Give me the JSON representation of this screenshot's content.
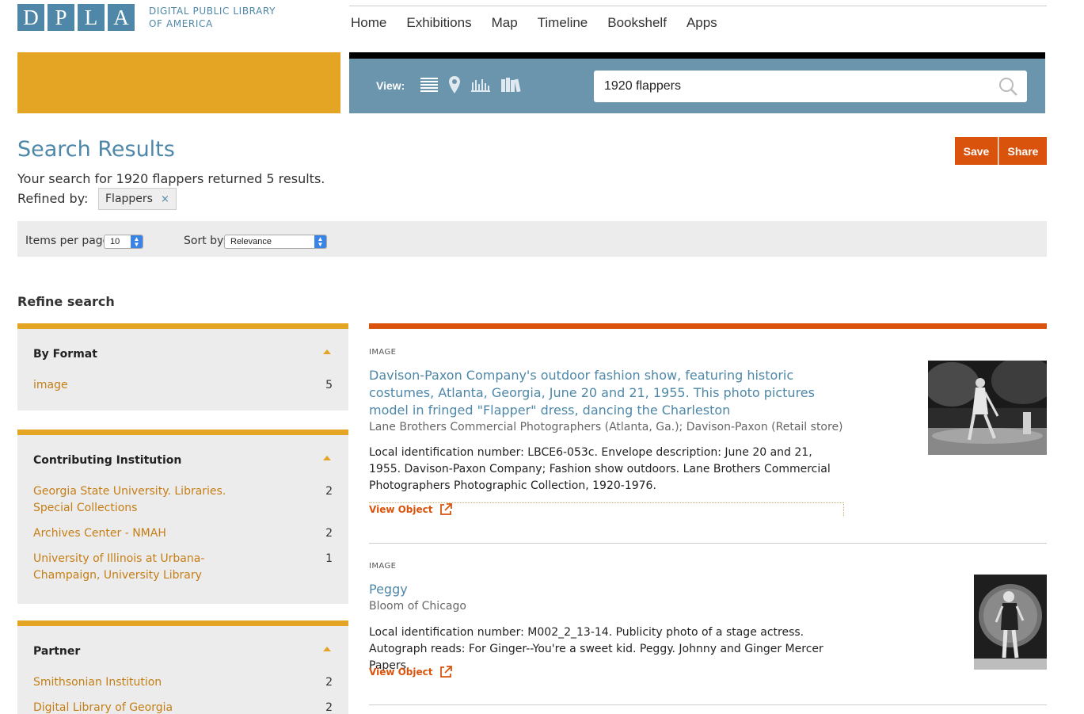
{
  "header": {
    "logo_letters": [
      "D",
      "P",
      "L",
      "A"
    ],
    "logo_line1": "DIGITAL PUBLIC LIBRARY",
    "logo_line2": "OF AMERICA",
    "nav": [
      "Home",
      "Exhibitions",
      "Map",
      "Timeline",
      "Bookshelf",
      "Apps"
    ]
  },
  "search": {
    "view_label": "View:",
    "view_icons": [
      "list-view-icon",
      "map-view-icon",
      "timeline-view-icon",
      "bookshelf-view-icon"
    ],
    "query": "1920 flappers"
  },
  "results_header": {
    "title": "Search Results",
    "save": "Save",
    "share": "Share",
    "summary": "Your search for 1920 flappers returned 5 results.",
    "refined_label": "Refined by:",
    "refine_chip": "Flappers",
    "chip_remove": "×"
  },
  "toolbar": {
    "items_per_page_label": "Items per page:",
    "items_per_page_value": "10",
    "sort_label": "Sort by:",
    "sort_value": "Relevance"
  },
  "sidebar": {
    "title": "Refine search",
    "facets": [
      {
        "heading": "By Format",
        "items": [
          {
            "label": "image",
            "count": "5"
          }
        ]
      },
      {
        "heading": "Contributing Institution",
        "items": [
          {
            "label": "Georgia State University. Libraries. Special Collections",
            "count": "2"
          },
          {
            "label": "Archives Center - NMAH",
            "count": "2"
          },
          {
            "label": "University of Illinois at Urbana-Champaign, University Library",
            "count": "1"
          }
        ]
      },
      {
        "heading": "Partner",
        "items": [
          {
            "label": "Smithsonian Institution",
            "count": "2"
          },
          {
            "label": "Digital Library of Georgia",
            "count": "2"
          }
        ]
      }
    ]
  },
  "results": [
    {
      "type": "IMAGE",
      "title": "Davison-Paxon Company's outdoor fashion show, featuring historic costumes, Atlanta, Georgia, June 20 and 21, 1955. This photo pictures model in fringed \"Flapper\" dress, dancing the Charleston",
      "creator": "Lane Brothers Commercial Photographers (Atlanta, Ga.); Davison-Paxon (Retail store)",
      "description": "Local identification number: LBCE6-053c. Envelope description: June 20 and 21, 1955. Davison-Paxon Company; Fashion show outdoors. Lane Brothers Commercial Photographers Photographic Collection, 1920-1976.",
      "view_object": "View Object"
    },
    {
      "type": "IMAGE",
      "title": "Peggy",
      "creator": "Bloom of Chicago",
      "description": "Local identification number: M002_2_13-14. Publicity photo of a stage actress. Autograph reads: For Ginger--You're a sweet kid. Peggy. Johnny and Ginger Mercer Papers.",
      "view_object": "View Object"
    }
  ],
  "colors": {
    "brand_blue": "#4e87a8",
    "accent_orange": "#d9530c",
    "accent_yellow": "#e5a524"
  }
}
